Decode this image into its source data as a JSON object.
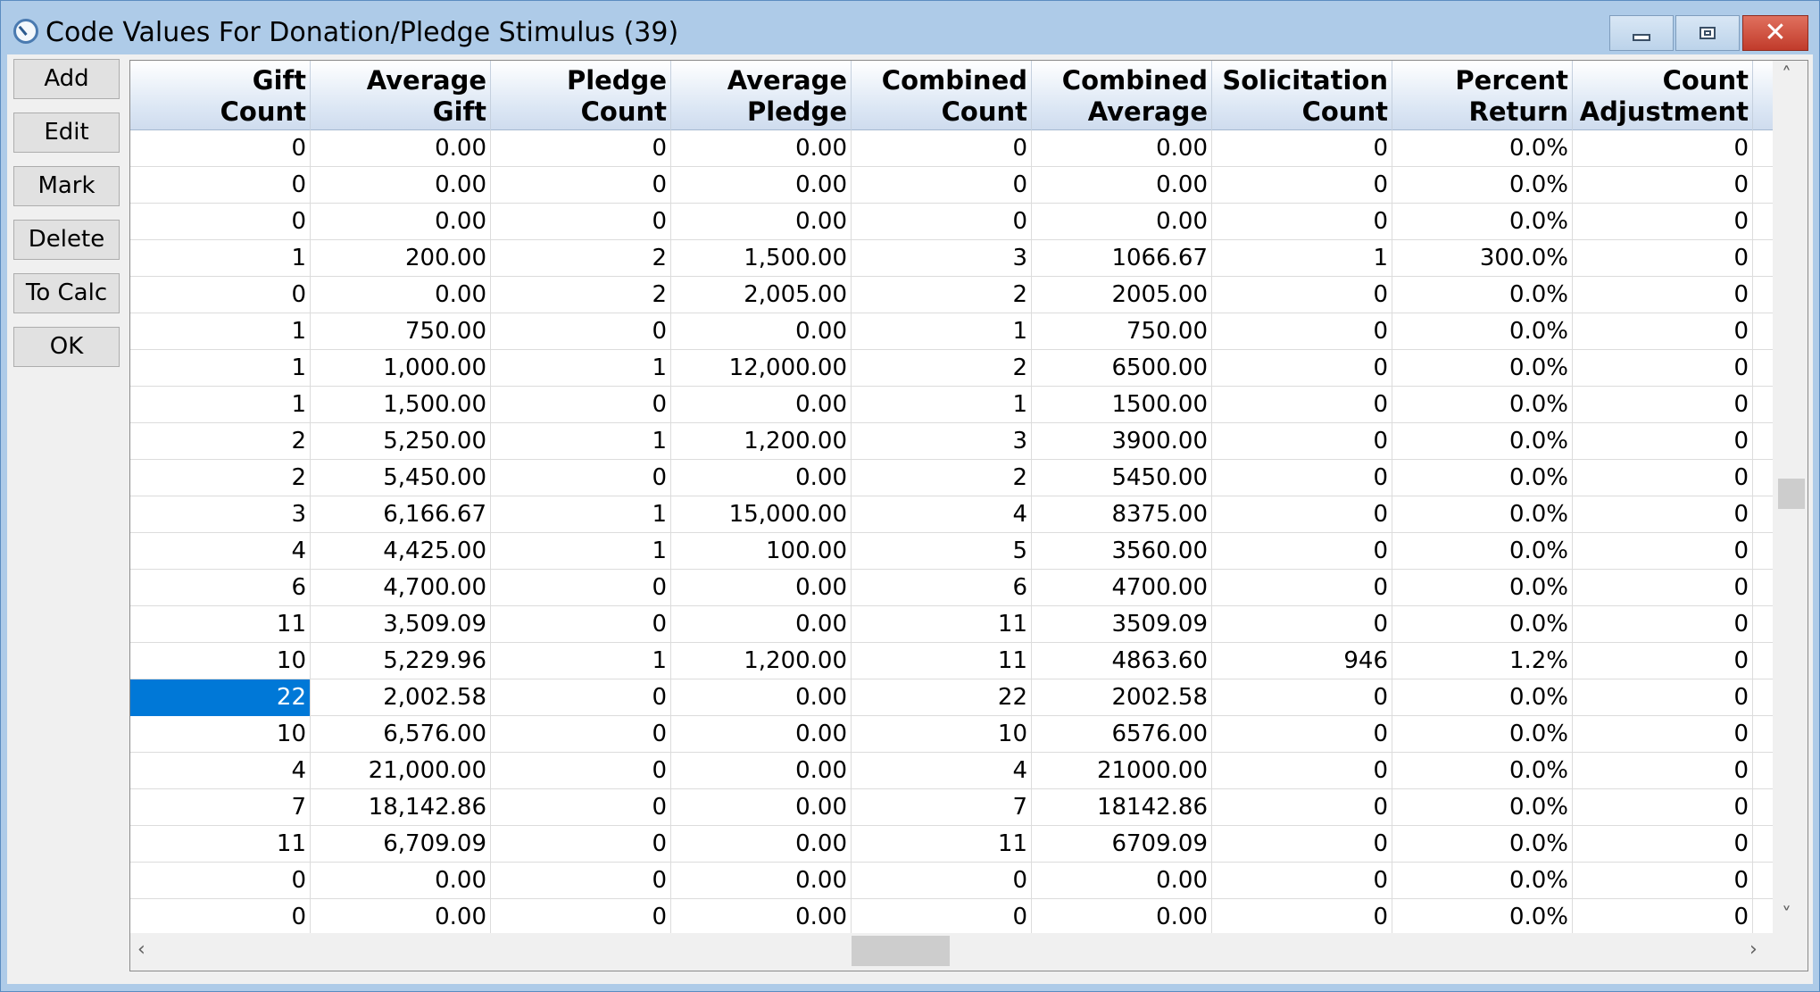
{
  "window": {
    "title": "Code Values For Donation/Pledge Stimulus (39)"
  },
  "sidebar": {
    "buttons": [
      "Add",
      "Edit",
      "Mark",
      "Delete",
      "To Calc",
      "OK"
    ]
  },
  "grid": {
    "columns": [
      {
        "line1": "Gift",
        "line2": "Count"
      },
      {
        "line1": "Average",
        "line2": "Gift"
      },
      {
        "line1": "Pledge",
        "line2": "Count"
      },
      {
        "line1": "Average",
        "line2": "Pledge"
      },
      {
        "line1": "Combined",
        "line2": "Count"
      },
      {
        "line1": "Combined",
        "line2": "Average"
      },
      {
        "line1": "Solicitation",
        "line2": "Count"
      },
      {
        "line1": "Percent",
        "line2": "Return"
      },
      {
        "line1": "Count",
        "line2": "Adjustment"
      }
    ],
    "selected": {
      "row": 15,
      "col": 0
    },
    "rows": [
      [
        "0",
        "0.00",
        "0",
        "0.00",
        "0",
        "0.00",
        "0",
        "0.0%",
        "0"
      ],
      [
        "0",
        "0.00",
        "0",
        "0.00",
        "0",
        "0.00",
        "0",
        "0.0%",
        "0"
      ],
      [
        "0",
        "0.00",
        "0",
        "0.00",
        "0",
        "0.00",
        "0",
        "0.0%",
        "0"
      ],
      [
        "1",
        "200.00",
        "2",
        "1,500.00",
        "3",
        "1066.67",
        "1",
        "300.0%",
        "0"
      ],
      [
        "0",
        "0.00",
        "2",
        "2,005.00",
        "2",
        "2005.00",
        "0",
        "0.0%",
        "0"
      ],
      [
        "1",
        "750.00",
        "0",
        "0.00",
        "1",
        "750.00",
        "0",
        "0.0%",
        "0"
      ],
      [
        "1",
        "1,000.00",
        "1",
        "12,000.00",
        "2",
        "6500.00",
        "0",
        "0.0%",
        "0"
      ],
      [
        "1",
        "1,500.00",
        "0",
        "0.00",
        "1",
        "1500.00",
        "0",
        "0.0%",
        "0"
      ],
      [
        "2",
        "5,250.00",
        "1",
        "1,200.00",
        "3",
        "3900.00",
        "0",
        "0.0%",
        "0"
      ],
      [
        "2",
        "5,450.00",
        "0",
        "0.00",
        "2",
        "5450.00",
        "0",
        "0.0%",
        "0"
      ],
      [
        "3",
        "6,166.67",
        "1",
        "15,000.00",
        "4",
        "8375.00",
        "0",
        "0.0%",
        "0"
      ],
      [
        "4",
        "4,425.00",
        "1",
        "100.00",
        "5",
        "3560.00",
        "0",
        "0.0%",
        "0"
      ],
      [
        "6",
        "4,700.00",
        "0",
        "0.00",
        "6",
        "4700.00",
        "0",
        "0.0%",
        "0"
      ],
      [
        "11",
        "3,509.09",
        "0",
        "0.00",
        "11",
        "3509.09",
        "0",
        "0.0%",
        "0"
      ],
      [
        "10",
        "5,229.96",
        "1",
        "1,200.00",
        "11",
        "4863.60",
        "946",
        "1.2%",
        "0"
      ],
      [
        "22",
        "2,002.58",
        "0",
        "0.00",
        "22",
        "2002.58",
        "0",
        "0.0%",
        "0"
      ],
      [
        "10",
        "6,576.00",
        "0",
        "0.00",
        "10",
        "6576.00",
        "0",
        "0.0%",
        "0"
      ],
      [
        "4",
        "21,000.00",
        "0",
        "0.00",
        "4",
        "21000.00",
        "0",
        "0.0%",
        "0"
      ],
      [
        "7",
        "18,142.86",
        "0",
        "0.00",
        "7",
        "18142.86",
        "0",
        "0.0%",
        "0"
      ],
      [
        "11",
        "6,709.09",
        "0",
        "0.00",
        "11",
        "6709.09",
        "0",
        "0.0%",
        "0"
      ],
      [
        "0",
        "0.00",
        "0",
        "0.00",
        "0",
        "0.00",
        "0",
        "0.0%",
        "0"
      ],
      [
        "0",
        "0.00",
        "0",
        "0.00",
        "0",
        "0.00",
        "0",
        "0.0%",
        "0"
      ]
    ]
  },
  "icons": {
    "app": "compass-icon",
    "minimize": "minimize-icon",
    "maximize": "maximize-icon",
    "close": "close-icon",
    "scroll_up": "chevron-up-icon",
    "scroll_down": "chevron-down-icon",
    "scroll_left": "chevron-left-icon",
    "scroll_right": "chevron-right-icon"
  },
  "colors": {
    "selection": "#0078d7",
    "titlebar": "#aecbe8",
    "close_button": "#c13b2b"
  }
}
